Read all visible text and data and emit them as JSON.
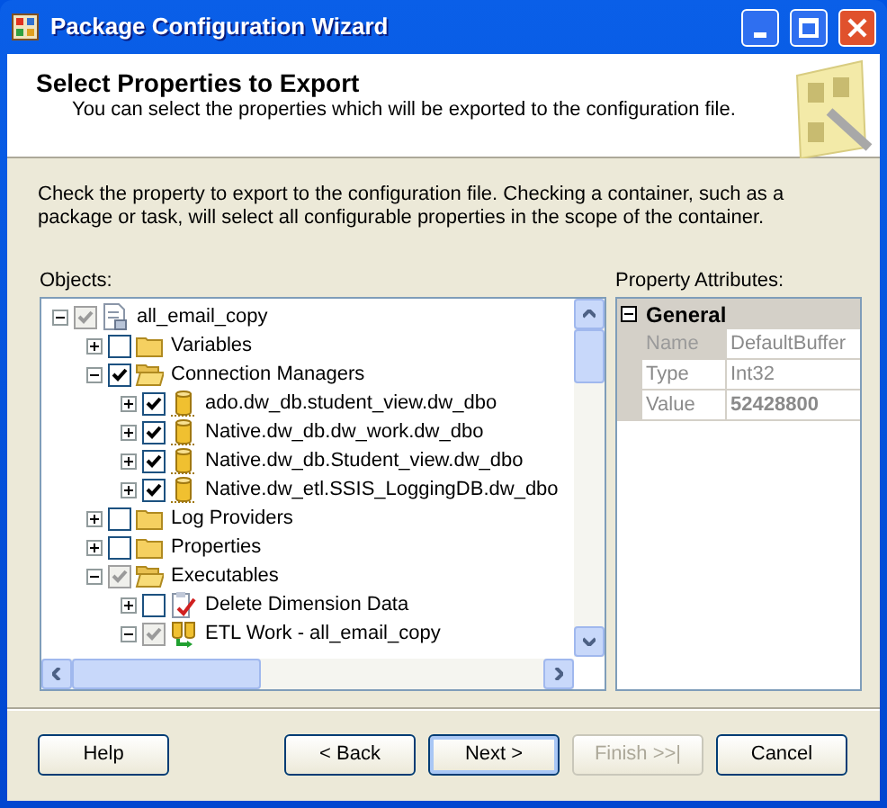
{
  "window": {
    "title": "Package Configuration Wizard"
  },
  "header": {
    "title": "Select Properties to Export",
    "subtitle": "You can select the properties which will be exported to the configuration file."
  },
  "instructions": "Check the property to export to the configuration file. Checking a container, such as a package or task, will select all configurable properties in the scope of the container.",
  "objects": {
    "label": "Objects:",
    "tree": [
      {
        "label": "all_email_copy",
        "kind": "package",
        "checked": true,
        "grayed": true,
        "expanded": true,
        "children": [
          {
            "label": "Variables",
            "kind": "folder",
            "checked": false,
            "grayed": false,
            "expanded": false
          },
          {
            "label": "Connection Managers",
            "kind": "folder",
            "checked": true,
            "grayed": false,
            "expanded": true,
            "children": [
              {
                "label": "ado.dw_db.student_view.dw_dbo",
                "kind": "connection",
                "checked": true,
                "grayed": false,
                "expanded": false
              },
              {
                "label": "Native.dw_db.dw_work.dw_dbo",
                "kind": "connection",
                "checked": true,
                "grayed": false,
                "expanded": false
              },
              {
                "label": "Native.dw_db.Student_view.dw_dbo",
                "kind": "connection",
                "checked": true,
                "grayed": false,
                "expanded": false
              },
              {
                "label": "Native.dw_etl.SSIS_LoggingDB.dw_dbo",
                "kind": "connection",
                "checked": true,
                "grayed": false,
                "expanded": false
              }
            ]
          },
          {
            "label": "Log Providers",
            "kind": "folder",
            "checked": false,
            "grayed": false,
            "expanded": false
          },
          {
            "label": "Properties",
            "kind": "folder",
            "checked": false,
            "grayed": false,
            "expanded": false
          },
          {
            "label": "Executables",
            "kind": "folder",
            "checked": true,
            "grayed": true,
            "expanded": true,
            "children": [
              {
                "label": "Delete Dimension Data",
                "kind": "task",
                "checked": false,
                "grayed": false,
                "expanded": false
              },
              {
                "label": "ETL Work - all_email_copy",
                "kind": "container",
                "checked": true,
                "grayed": true,
                "expanded": true
              }
            ]
          }
        ]
      }
    ]
  },
  "property_attributes": {
    "label": "Property Attributes:",
    "category": {
      "label": "General",
      "expanded": true
    },
    "rows": [
      {
        "name": "Name",
        "value": "DefaultBuffer",
        "selected": true,
        "bold": false
      },
      {
        "name": "Type",
        "value": "Int32",
        "selected": false,
        "bold": false
      },
      {
        "name": "Value",
        "value": "52428800",
        "selected": false,
        "bold": true
      }
    ]
  },
  "buttons": [
    {
      "label": "Help",
      "disabled": false,
      "default": false
    },
    {
      "label": "< Back",
      "disabled": false,
      "default": false
    },
    {
      "label": "Next >",
      "disabled": false,
      "default": true
    },
    {
      "label": "Finish >>|",
      "disabled": true,
      "default": false
    },
    {
      "label": "Cancel",
      "disabled": false,
      "default": false
    }
  ]
}
